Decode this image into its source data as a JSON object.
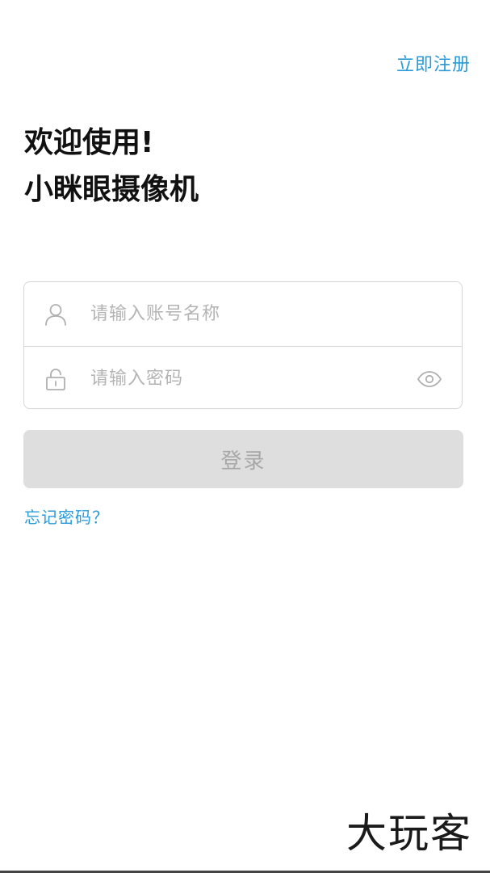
{
  "header": {
    "register_label": "立即注册"
  },
  "welcome": {
    "line1": "欢迎使用!",
    "line2": "小眯眼摄像机"
  },
  "form": {
    "account": {
      "icon": "user-icon",
      "value": "",
      "placeholder": "请输入账号名称"
    },
    "password": {
      "icon": "lock-icon",
      "value": "",
      "placeholder": "请输入密码",
      "toggle_icon": "eye-icon"
    }
  },
  "login": {
    "label": "登录"
  },
  "forgot": {
    "label": "忘记密码？"
  },
  "watermark": {
    "text": "大玩客"
  },
  "colors": {
    "accent": "#2b9bd8",
    "title": "#111111",
    "border": "#d6d6d6",
    "button_bg": "#dedede",
    "button_text": "#a8a8a8",
    "placeholder": "#b4b4b4"
  }
}
